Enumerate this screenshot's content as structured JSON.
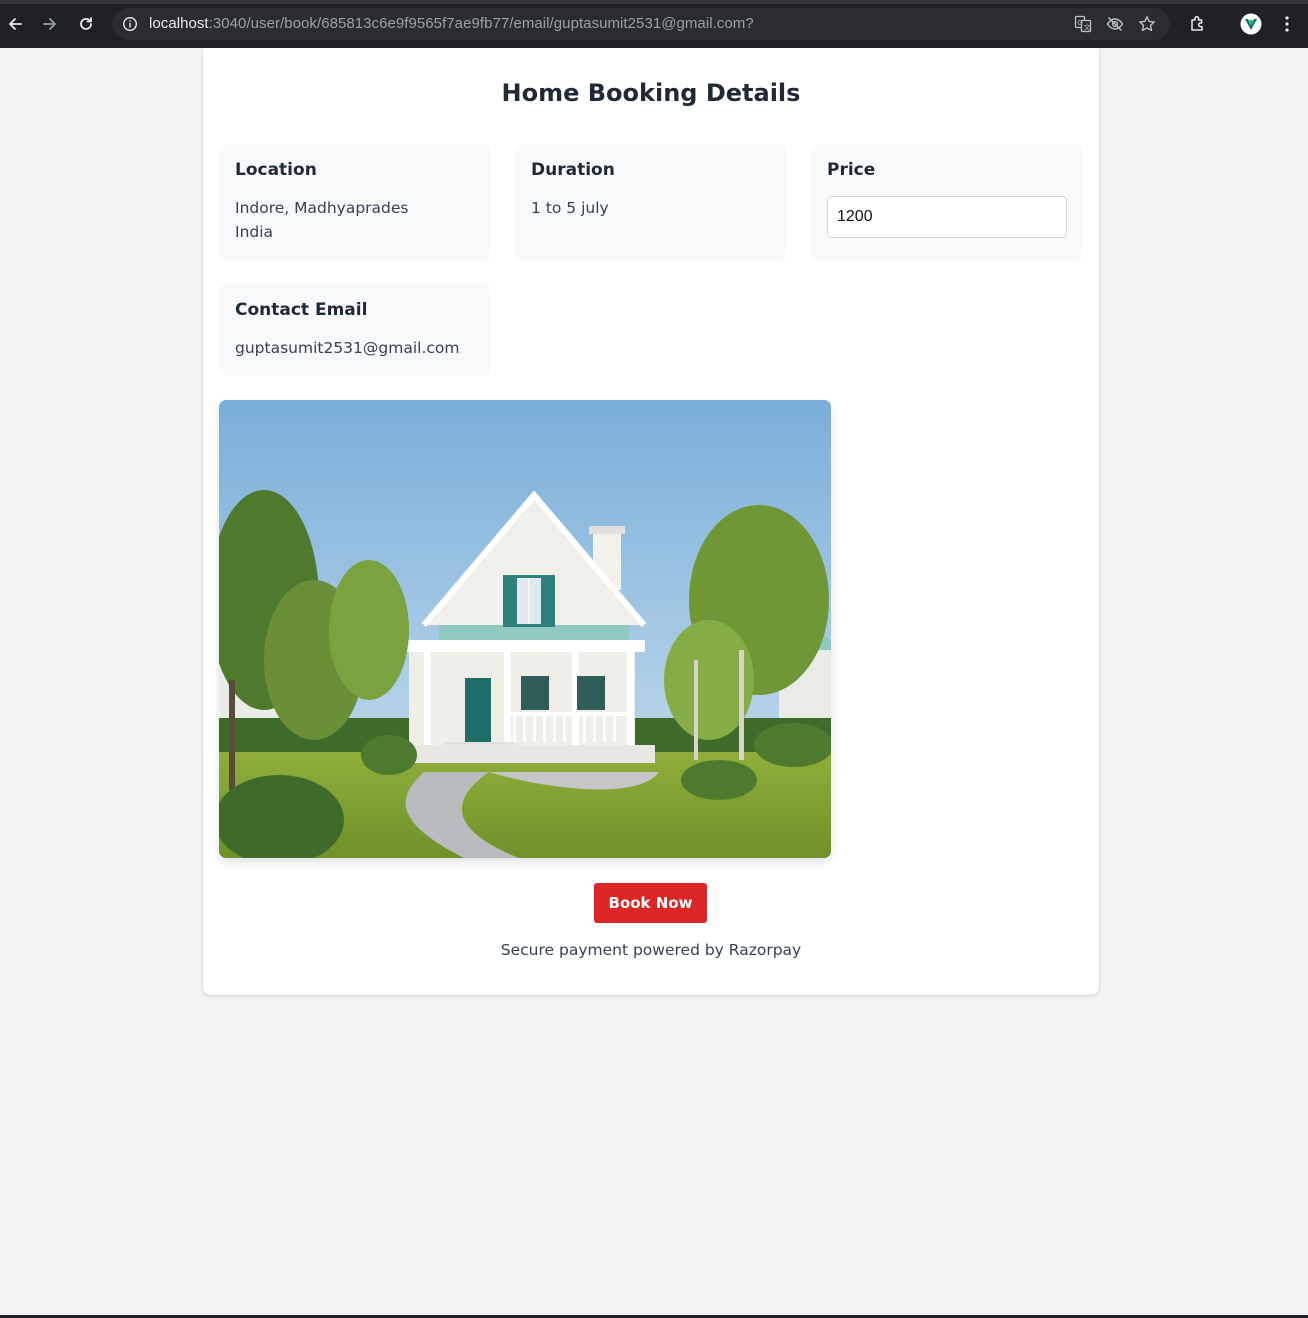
{
  "browser": {
    "url_host": "localhost",
    "url_rest": ":3040/user/book/685813c6e9f9565f7ae9fb77/email/guptasumit2531@gmail.com?"
  },
  "page": {
    "title": "Home Booking Details",
    "location": {
      "label": "Location",
      "line1": "Indore, Madhyaprades",
      "line2": "India"
    },
    "duration": {
      "label": "Duration",
      "value": "1 to 5 july"
    },
    "price": {
      "label": "Price",
      "value": "1200"
    },
    "contact": {
      "label": "Contact Email",
      "value": "guptasumit2531@gmail.com"
    },
    "book_button": "Book Now",
    "secure_note": "Secure payment powered by Razorpay"
  },
  "colors": {
    "accent": "#dc2626",
    "page_bg": "#f2f3f5",
    "card_bg": "#ffffff",
    "chrome_bg": "#202124"
  },
  "icons": [
    "back-arrow-icon",
    "forward-arrow-icon",
    "reload-icon",
    "site-info-icon",
    "translate-icon",
    "eye-off-icon",
    "star-icon",
    "extensions-icon",
    "profile-avatar",
    "more-menu-icon"
  ]
}
